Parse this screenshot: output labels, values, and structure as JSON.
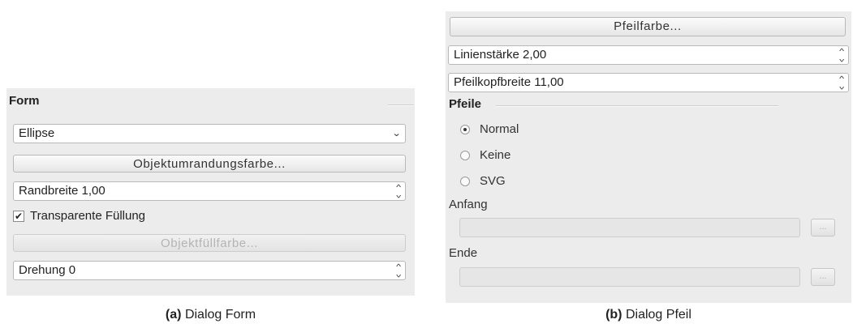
{
  "dialog_form": {
    "section_title": "Form",
    "shape_select": {
      "value": "Ellipse"
    },
    "outline_color_button": "Objektumrandungsfarbe...",
    "border_width_spin": {
      "value": "Randbreite 1,00"
    },
    "transparent_fill_checkbox": {
      "label": "Transparente Füllung",
      "checked": true,
      "mark": "✔"
    },
    "fill_color_button": "Objektfüllfarbe...",
    "rotation_spin": {
      "value": "Drehung 0"
    },
    "caption": {
      "tag": "(a)",
      "text": "Dialog Form"
    }
  },
  "dialog_pfeil": {
    "arrow_color_button": "Pfeilfarbe...",
    "line_width_spin": {
      "value": "Linienstärke 2,00"
    },
    "arrowhead_width_spin": {
      "value": "Pfeilkopfbreite 11,00"
    },
    "section_title": "Pfeile",
    "arrow_type": {
      "options": [
        "Normal",
        "Keine",
        "SVG"
      ],
      "selected": "Normal"
    },
    "start_label": "Anfang",
    "end_label": "Ende",
    "browse_button_label": "...",
    "caption": {
      "tag": "(b)",
      "text": "Dialog Pfeil"
    }
  },
  "icons": {
    "spin": "up-down-chevrons-icon",
    "dropdown": "chevron-down-icon",
    "radio": "radio-button-icon",
    "checkbox": "checkbox-icon"
  }
}
